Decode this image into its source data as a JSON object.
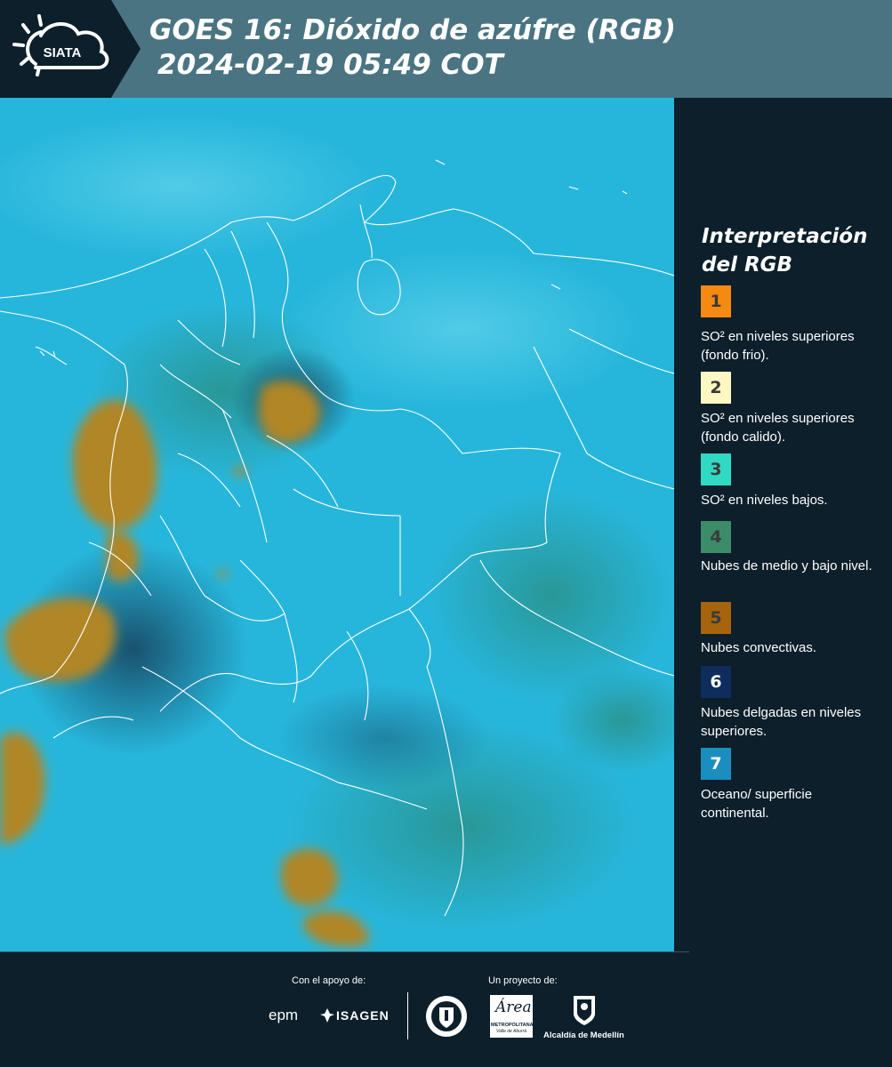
{
  "header": {
    "logo_text": "SIATA",
    "title_line1": "GOES 16: Dióxido de azúfre (RGB)",
    "title_line2": "2024-02-19 05:49 COT"
  },
  "legend": {
    "title_line1": "Interpretación",
    "title_line2": "del RGB",
    "items": [
      {
        "number": "1",
        "color": "#f58a12",
        "text": "SO² en niveles superiores (fondo frio)."
      },
      {
        "number": "2",
        "color": "#fdf7c4",
        "text": "SO² en niveles superiores (fondo calido)."
      },
      {
        "number": "3",
        "color": "#2fd9c2",
        "text": "SO² en niveles bajos."
      },
      {
        "number": "4",
        "color": "#3c8c6a",
        "text": "Nubes de medio y bajo nivel."
      },
      {
        "number": "5",
        "color": "#a6640c",
        "text": "Nubes convectivas."
      },
      {
        "number": "6",
        "color": "#0e2d5c",
        "text": "Nubes delgadas en niveles superiores."
      },
      {
        "number": "7",
        "color": "#1a8fbf",
        "text": "Oceano/ superficie continental."
      }
    ]
  },
  "footer": {
    "support_label": "Con el apoyo de:",
    "project_label": "Un proyecto de:",
    "logo_epm": "epm",
    "logo_isagen": "ISAGEN",
    "logo_area_script": "Área",
    "logo_area_line1": "METROPOLITANA",
    "logo_area_line2": "Valle de Aburrá",
    "logo_alcaldia": "Alcaldía de Medellín"
  },
  "colors": {
    "map_background": "#27b6db",
    "convective_clouds": "#b08628",
    "header_band": "#4a7482",
    "page_background": "#0c1f2b"
  }
}
